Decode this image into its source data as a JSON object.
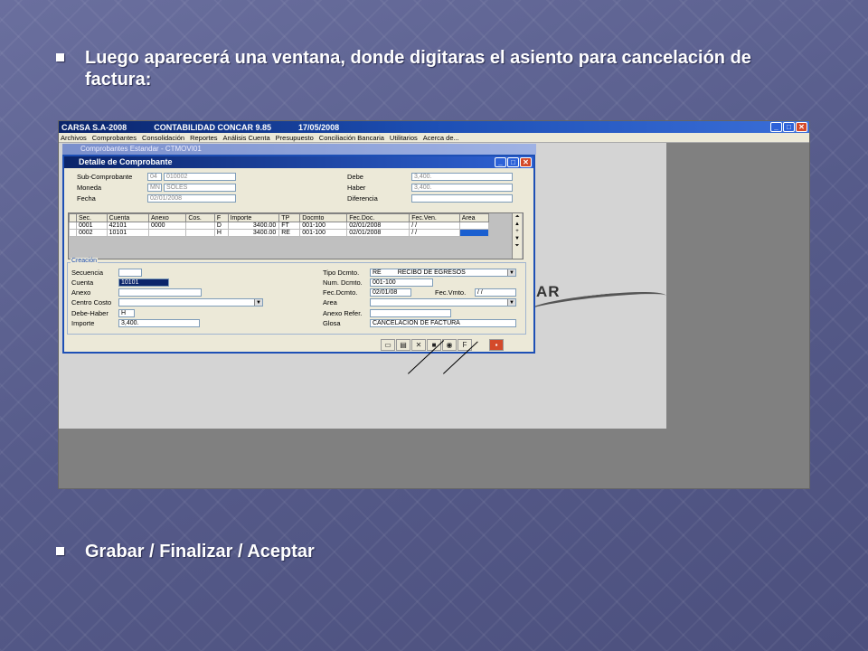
{
  "slide": {
    "bullet1": "Luego aparecerá una ventana, donde digitaras el asiento para cancelación de factura:",
    "bullet2": "Grabar / Finalizar / Aceptar"
  },
  "app": {
    "title_company": "CARSA S.A-2008",
    "title_app": "CONTABILIDAD CONCAR 9.85",
    "title_date": "17/05/2008",
    "menu": [
      "Archivos",
      "Comprobantes",
      "Consolidación",
      "Reportes",
      "Análisis Cuenta",
      "Presupuesto",
      "Conciliación Bancaria",
      "Utilitarios",
      "Acerca de..."
    ],
    "bg_window_title": "Comprobantes Estandar - CTMOVI01",
    "bg_text": "AR"
  },
  "dialog": {
    "title": "Detalle de Comprobante",
    "header": {
      "sub_comprobante_label": "Sub-Comprobante",
      "sub_comprobante_code": "04",
      "sub_comprobante_num": "010002",
      "moneda_label": "Moneda",
      "moneda_code": "MN",
      "moneda_name": "SOLES",
      "fecha_label": "Fecha",
      "fecha_value": "02/01/2008",
      "debe_label": "Debe",
      "debe_value": "3,400.",
      "haber_label": "Haber",
      "haber_value": "3,400.",
      "diferencia_label": "Diferencia",
      "diferencia_value": ""
    },
    "grid": {
      "columns": [
        "Sec.",
        "Cuenta",
        "Anexo",
        "Cos.",
        "F",
        "Importe",
        "TP",
        "Docmto",
        "Fec.Doc.",
        "Fec.Ven.",
        "Area"
      ],
      "rows": [
        [
          "0001",
          "42101",
          "0000",
          "",
          "D",
          "3400.00",
          "FT",
          "001-100",
          "02/01/2008",
          "/  /",
          ""
        ],
        [
          "0002",
          "10101",
          "",
          "",
          "H",
          "3400.00",
          "RE",
          "001-100",
          "02/01/2008",
          "/  /",
          ""
        ]
      ]
    },
    "creacion": {
      "group_label": "Creación",
      "secuencia_label": "Secuencia",
      "secuencia_value": "",
      "cuenta_label": "Cuenta",
      "cuenta_value": "10101",
      "anexo_label": "Anexo",
      "anexo_value": "",
      "centro_costo_label": "Centro Costo",
      "centro_costo_value": "",
      "debe_haber_label": "Debe-Haber",
      "debe_haber_value": "H",
      "importe_label": "Importe",
      "importe_value": "3,400.",
      "tipo_dcmto_label": "Tipo Dcmto.",
      "tipo_dcmto_code": "RE",
      "tipo_dcmto_name": "RECIBO DE EGRESOS",
      "num_dcmto_label": "Num. Dcmto.",
      "num_dcmto_value": "001-100",
      "fec_dcmto_label": "Fec.Dcmto.",
      "fec_dcmto_value": "02/01/08",
      "fec_vmto_label": "Fec.Vmto.",
      "fec_vmto_value": "/  /",
      "area_label": "Area",
      "area_value": "",
      "anexo_refer_label": "Anexo Refer.",
      "anexo_refer_value": "",
      "glosa_label": "Glosa",
      "glosa_value": "CANCELACION DE FACTURA"
    },
    "toolbar": {
      "finalizar_label": "F"
    }
  },
  "icons": [
    "new-icon",
    "open-icon",
    "delete-icon",
    "save-icon",
    "search-icon",
    "finalize-icon",
    "exit-icon"
  ]
}
